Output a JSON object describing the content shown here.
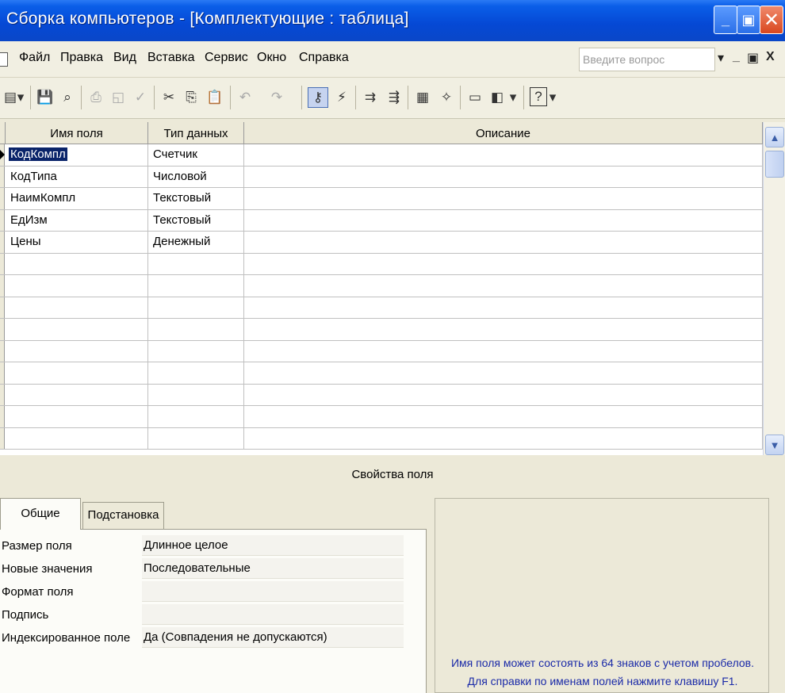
{
  "window": {
    "title": "Сборка компьютеров - [Комплектующие : таблица]",
    "min_glyph": "_",
    "max_glyph": "▣",
    "close_glyph": "✕"
  },
  "menu": {
    "items": [
      "Файл",
      "Правка",
      "Вид",
      "Вставка",
      "Сервис",
      "Окно",
      "Справка"
    ],
    "ask_placeholder": "Введите вопрос",
    "doc_controls": [
      "▾",
      "_",
      "▣",
      "X"
    ]
  },
  "toolbar": {
    "icons": [
      {
        "name": "view-icon",
        "glyph": "▤"
      },
      {
        "name": "dropdown-icon",
        "glyph": "▾"
      },
      {
        "name": "save-icon",
        "glyph": "💾"
      },
      {
        "name": "search-icon",
        "glyph": "⌕"
      },
      {
        "name": "print-icon",
        "glyph": "⎙"
      },
      {
        "name": "preview-icon",
        "glyph": "◱"
      },
      {
        "name": "spelling-icon",
        "glyph": "✓"
      },
      {
        "name": "cut-icon",
        "glyph": "✂"
      },
      {
        "name": "copy-icon",
        "glyph": "⎘"
      },
      {
        "name": "paste-icon",
        "glyph": "📋"
      },
      {
        "name": "undo-icon",
        "glyph": "↶"
      },
      {
        "name": "redo-icon",
        "glyph": "↷"
      },
      {
        "name": "primary-key-icon",
        "glyph": "⚷"
      },
      {
        "name": "indexes-icon",
        "glyph": "⚡"
      },
      {
        "name": "insert-rows-icon",
        "glyph": "⇉"
      },
      {
        "name": "delete-rows-icon",
        "glyph": "⇶"
      },
      {
        "name": "properties-icon",
        "glyph": "▦"
      },
      {
        "name": "build-icon",
        "glyph": "✧"
      },
      {
        "name": "database-window-icon",
        "glyph": "▭"
      },
      {
        "name": "new-object-icon",
        "glyph": "◧"
      },
      {
        "name": "help-icon",
        "glyph": "?"
      }
    ]
  },
  "grid": {
    "headers": [
      "Имя поля",
      "Тип данных",
      "Описание"
    ],
    "rows": [
      {
        "name": "КодКомпл",
        "type": "Счетчик",
        "desc": ""
      },
      {
        "name": "КодТипа",
        "type": "Числовой",
        "desc": ""
      },
      {
        "name": "НаимКомпл",
        "type": "Текстовый",
        "desc": ""
      },
      {
        "name": "ЕдИзм",
        "type": "Текстовый",
        "desc": ""
      },
      {
        "name": "Цены",
        "type": "Денежный",
        "desc": ""
      }
    ]
  },
  "properties": {
    "section_title": "Свойства поля",
    "tabs": [
      "Общие",
      "Подстановка"
    ],
    "fields": [
      {
        "label": "Размер поля",
        "value": "Длинное целое"
      },
      {
        "label": "Новые значения",
        "value": "Последовательные"
      },
      {
        "label": "Формат поля",
        "value": ""
      },
      {
        "label": "Подпись",
        "value": ""
      },
      {
        "label": "Индексированное поле",
        "value": "Да (Совпадения не допускаются)"
      }
    ],
    "help_lines": [
      "Имя поля может состоять из 64 знаков с учетом пробелов.",
      "Для справки по именам полей нажмите клавишу F1."
    ]
  }
}
